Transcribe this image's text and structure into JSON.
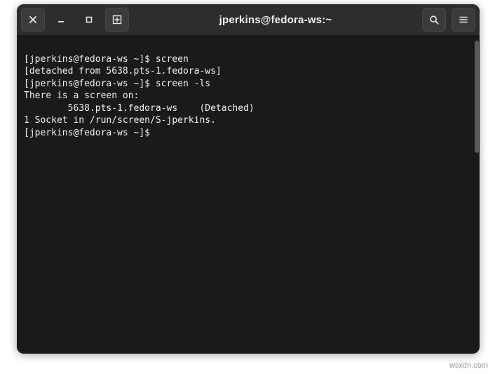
{
  "window": {
    "title": "jperkins@fedora-ws:~"
  },
  "terminal": {
    "lines": {
      "l0": "[jperkins@fedora-ws ~]$ screen",
      "l1": "[detached from 5638.pts-1.fedora-ws]",
      "l2": "[jperkins@fedora-ws ~]$ screen -ls",
      "l3": "There is a screen on:",
      "l4": "        5638.pts-1.fedora-ws    (Detached)",
      "l5": "1 Socket in /run/screen/S-jperkins.",
      "l6": "[jperkins@fedora-ws ~]$ "
    }
  },
  "watermark": "wsxdn.com"
}
